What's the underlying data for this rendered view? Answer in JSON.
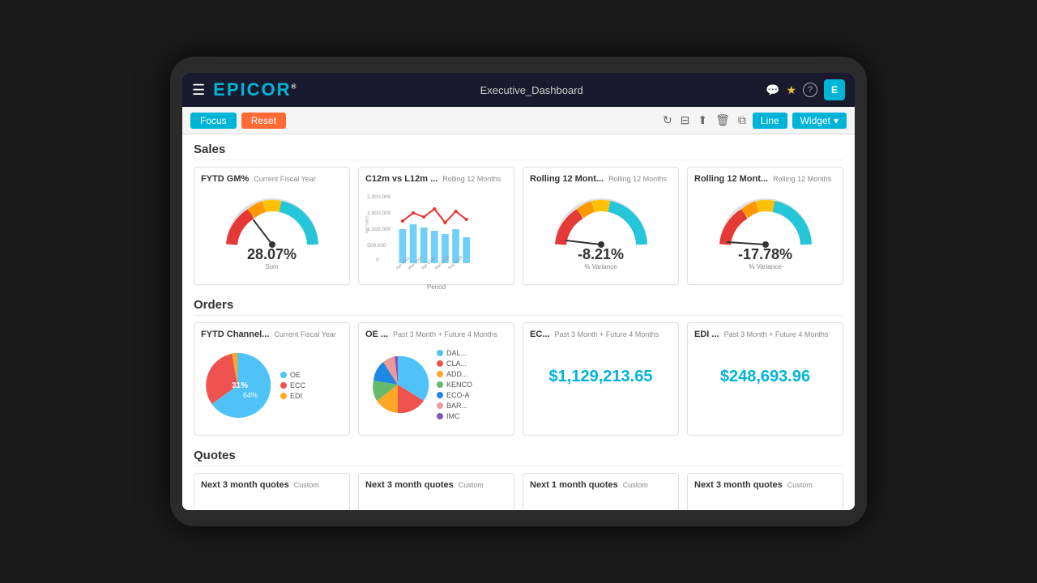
{
  "header": {
    "menu_icon": "☰",
    "logo_text": "EPICOR",
    "logo_dot": "®",
    "title": "Executive_Dashboard",
    "icons": {
      "chat": "💬",
      "star": "★",
      "help": "?",
      "user_initial": "E"
    }
  },
  "toolbar": {
    "focus_label": "Focus",
    "reset_label": "Reset",
    "refresh_icon": "↻",
    "save_icon": "💾",
    "users_icon": "👤",
    "delete_icon": "🗑",
    "copy_icon": "⧉",
    "line_label": "Line",
    "widget_label": "Widget",
    "widget_arrow": "▾"
  },
  "sections": {
    "sales": {
      "title": "Sales",
      "widgets": [
        {
          "id": "fytd-gm",
          "title": "FYTD GM%",
          "subtitle": "Current Fiscal Year",
          "type": "gauge",
          "value": "28.07%",
          "label": "Sum",
          "gauge_segments": [
            "red",
            "orange",
            "yellow",
            "teal",
            "teal"
          ],
          "needle_angle": -20
        },
        {
          "id": "c12m-l12m",
          "title": "C12m vs L12m ...",
          "subtitle": "Rolling 12 Months",
          "type": "line_bar_chart",
          "y_labels": [
            "2,000,000",
            "1,500,000",
            "1,000,000",
            "500,000",
            "0"
          ],
          "x_label": "Period",
          "y_axis_label": "Net Sales"
        },
        {
          "id": "rolling-12-1",
          "title": "Rolling 12 Mont...",
          "subtitle": "Rolling 12 Months",
          "type": "gauge",
          "value": "-8.21%",
          "label": "% Variance",
          "needle_angle": -85
        },
        {
          "id": "rolling-12-2",
          "title": "Rolling 12 Mont...",
          "subtitle": "Rolling 12 Months",
          "type": "gauge",
          "value": "-17.78%",
          "label": "% Variance",
          "needle_angle": -95
        }
      ]
    },
    "orders": {
      "title": "Orders",
      "widgets": [
        {
          "id": "fytd-channel",
          "title": "FYTD Channel...",
          "subtitle": "Current Fiscal Year",
          "type": "pie",
          "center_label": "31%",
          "secondary_label": "64%",
          "legend": [
            {
              "label": "OE",
              "color": "#4fc3f7"
            },
            {
              "label": "ECC",
              "color": "#ef5350"
            },
            {
              "label": "EDI",
              "color": "#ffa726"
            }
          ],
          "slices": [
            {
              "color": "#4fc3f7",
              "pct": 64
            },
            {
              "color": "#ef5350",
              "pct": 31
            },
            {
              "color": "#ffa726",
              "pct": 5
            }
          ]
        },
        {
          "id": "oe",
          "title": "OE ...",
          "subtitle": "Past 3 Month + Future 4 Months",
          "type": "pie",
          "legend": [
            {
              "label": "DAL...",
              "color": "#4fc3f7"
            },
            {
              "label": "CLA...",
              "color": "#ef5350"
            },
            {
              "label": "ADD...",
              "color": "#ffa726"
            },
            {
              "label": "KENCO",
              "color": "#66bb6a"
            },
            {
              "label": "ECO-A",
              "color": "#1e88e5"
            },
            {
              "label": "BAR...",
              "color": "#ef9a9a"
            },
            {
              "label": "IMC",
              "color": "#7e57c2"
            }
          ],
          "slices": [
            {
              "color": "#4fc3f7",
              "pct": 45
            },
            {
              "color": "#ef5350",
              "pct": 25
            },
            {
              "color": "#ffa726",
              "pct": 15
            },
            {
              "color": "#66bb6a",
              "pct": 8
            },
            {
              "color": "#1e88e5",
              "pct": 4
            },
            {
              "color": "#ef9a9a",
              "pct": 2
            },
            {
              "color": "#7e57c2",
              "pct": 1
            }
          ]
        },
        {
          "id": "ec",
          "title": "EC...",
          "subtitle": "Past 3 Month + Future 4 Months",
          "type": "big_value",
          "value": "$1,129,213.65"
        },
        {
          "id": "edi",
          "title": "EDI ...",
          "subtitle": "Past 3 Month + Future 4 Months",
          "type": "big_value",
          "value": "$248,693.96"
        }
      ]
    },
    "quotes": {
      "title": "Quotes",
      "widgets": [
        {
          "id": "q1",
          "title": "Next 3 month quotes",
          "subtitle": "Custom"
        },
        {
          "id": "q2",
          "title": "Next 3 month quotes",
          "subtitle": "Custom"
        },
        {
          "id": "q3",
          "title": "Next 1 month quotes",
          "subtitle": "Custom"
        },
        {
          "id": "q4",
          "title": "Next 3 month quotes",
          "subtitle": "Custom"
        }
      ]
    }
  }
}
